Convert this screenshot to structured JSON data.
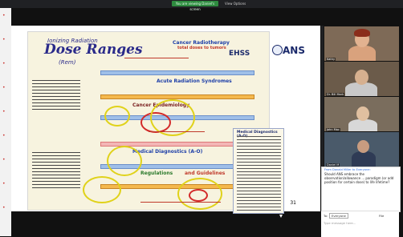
{
  "topbar": {
    "sharing_label": "You are viewing Daniel's screen",
    "view_options_label": "View Options"
  },
  "slide": {
    "title_line1": "Ionizing Radiation",
    "title_main": "Dose Ranges",
    "title_units": "(Rem)",
    "ehss_label": "EHSS",
    "ans_label": "ANS",
    "section_cancer_radiotherapy": "Cancer Radiotherapy",
    "section_total_doses": "total doses to tumors",
    "section_acute": "Acute Radiation Syndromes",
    "section_epidemiology": "Cancer Epidemiology",
    "section_medical": "Medical Diagnostics (A-O)",
    "section_regulations": "Regulations",
    "section_guidelines": "and Guidelines",
    "panel_title": "Medical Diagnostics (A-O)",
    "page_number": "31"
  },
  "gallery": {
    "tiles": [
      {
        "name": "Kathy"
      },
      {
        "name": "Dr. Bill Mark"
      },
      {
        "name": "John Mac"
      },
      {
        "name": "Daniel M"
      }
    ]
  },
  "chat": {
    "header": "From Donald Miller to Everyone:",
    "message": "Should ANS embrace the observation/allowance ... paradigm (or add position for certain dose) to life lifetime?",
    "to_label": "To:",
    "to_value": "Everyone",
    "file_label": "File",
    "placeholder": "Type message here..."
  },
  "colors": {
    "accent": "#2d6cdf",
    "sharing_green": "#2e8b3f",
    "ring_yellow": "#e0d21a",
    "ring_red": "#d32a2a"
  }
}
